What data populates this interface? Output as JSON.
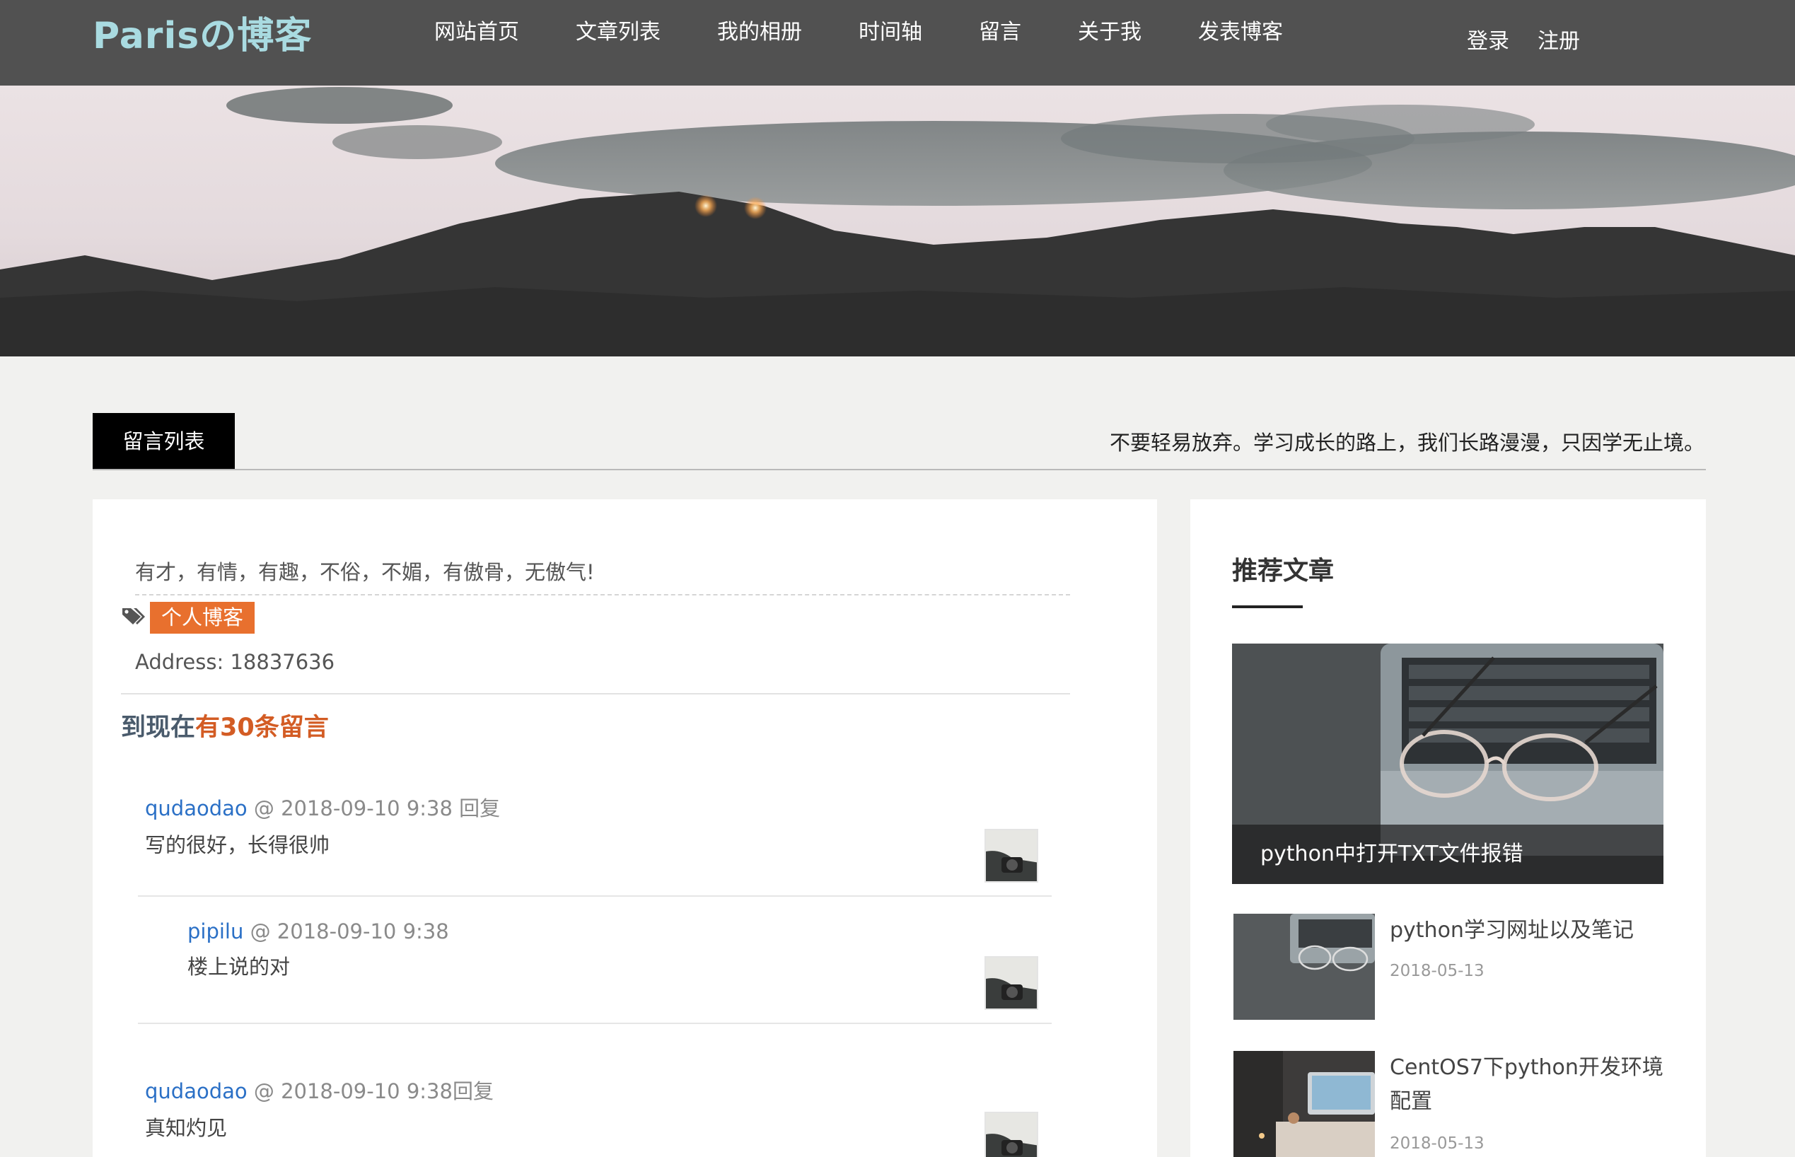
{
  "header": {
    "brand": "Parisの博客",
    "nav": [
      "网站首页",
      "文章列表",
      "我的相册",
      "时间轴",
      "留言",
      "关于我",
      "发表博客"
    ],
    "auth": [
      "登录",
      "注册"
    ]
  },
  "section": {
    "tab_label": "留言列表",
    "motto": "不要轻易放弃。学习成长的路上，我们长路漫漫，只因学无止境。"
  },
  "profile": {
    "intro": "有才，有情，有趣，不俗，不媚，有傲骨，无傲气!",
    "tag": "个人博客",
    "address": "Address: 18837636"
  },
  "messages": {
    "count_prefix": "到现在",
    "count_highlight": "有30条留言",
    "items": [
      {
        "user": "qudaodao",
        "meta": " @ 2018-09-10 9:38 ",
        "reply": "回复",
        "text": "写的很好，长得很帅"
      },
      {
        "user": "pipilu",
        "meta": " @ 2018-09-10 9:38",
        "reply": "",
        "text": "楼上说的对"
      },
      {
        "user": "qudaodao",
        "meta": " @ 2018-09-10 9:38",
        "reply": "回复",
        "text": "真知灼见"
      }
    ]
  },
  "sidebar": {
    "title": "推荐文章",
    "featured_title": "python中打开TXT文件报错",
    "posts": [
      {
        "title": "python学习网址以及笔记",
        "date": "2018-05-13"
      },
      {
        "title": "CentOS7下python开发环境配置",
        "date": "2018-05-13"
      }
    ]
  },
  "colors": {
    "header_bg": "#515151",
    "brand": "#a9dbe1",
    "tag_bg": "#e8702e",
    "count_highlight": "#d35c24",
    "username": "#2b70c6"
  }
}
